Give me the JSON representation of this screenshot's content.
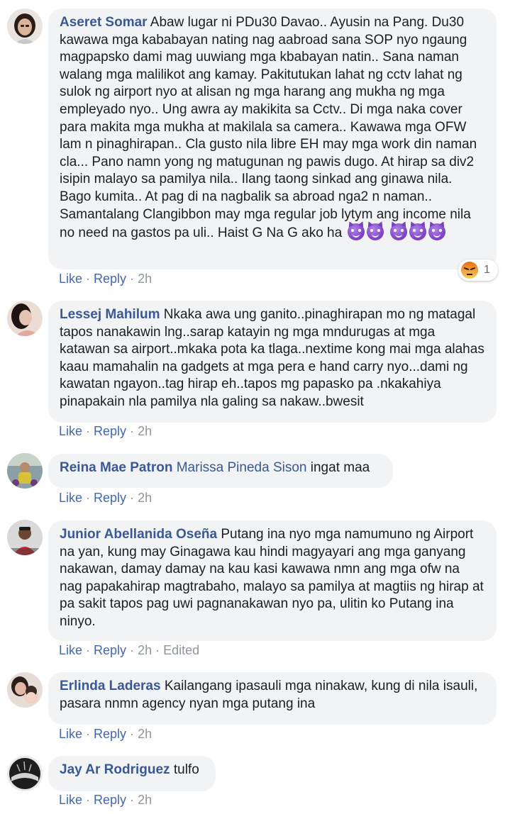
{
  "comments": [
    {
      "author": "Aseret Somar",
      "text": "Abaw lugar ni PDu30 Davao.. Ayusin na Pang. Du30 kawawa mga kababayan nating nag aabroad sana SOP nyo ngaung magpapsko dami mag uuwiang mga kbabayan natin.. Sana naman walang mga malilikot ang kamay. Pakitutukan lahat ng cctv lahat ng sulok ng airport nyo at alisan ng mga harang ang mukha ng mga empleyado nyo.. Ung awra ay makikita sa Cctv.. Di mga naka cover para makita mga mukha at makilala sa camera.. Kawawa mga OFW lam n pinaghirapan.. Cla gusto nila libre EH may mga work din naman cla... Pano namn yong ng matugunan ng pawis dugo. At hirap sa div2 isipin malayo sa pamilya nila.. Ilang taong sinkad ang ginawa nila. Bago kumita.. At pag di na nagbalik sa abroad nga2 n naman.. Samantalang Clangibbon may mga regular job lytym ang income nila no need na gastos pa uli.. Haist G Na G ako ha",
      "like": "Like",
      "reply": "Reply",
      "time": "2h",
      "reaction_count": "1",
      "emoji_icon": "smiling-devil-emoji-icon"
    },
    {
      "author": "Lessej Mahilum",
      "text": "Nkaka awa ung ganito..pinaghirapan mo ng matagal tapos nanakawin lng..sarap katayin ng mga mndurugas at mga katawan sa airport..mkaka pota ka tlaga..nextime kong mai mga alahas kaau mamahalin na gadgets at mga pera e hand carry nyo...dami ng kawatan ngayon..tag hirap eh..tapos mg papasko pa .nkakahiya pinapakain nla pamilya nla galing sa nakaw..bwesit",
      "like": "Like",
      "reply": "Reply",
      "time": "2h"
    },
    {
      "author": "Reina Mae Patron",
      "mention": "Marissa Pineda Sison",
      "text": "ingat maa",
      "like": "Like",
      "reply": "Reply",
      "time": "2h"
    },
    {
      "author": "Junior Abellanida Oseña",
      "text": "Putang ina nyo mga namumuno ng Airport na yan, kung may Ginagawa kau hindi magyayari ang mga ganyang nakawan, damay damay na kau kasi kawawa nmn ang mga ofw na nag papakahirap magtrabaho, malayo sa pamilya at magtiis ng hirap at pa sakit tapos pag uwi pagnanakawan nyo pa, ulitin ko Putang ina ninyo.",
      "like": "Like",
      "reply": "Reply",
      "time": "2h",
      "edited": "Edited"
    },
    {
      "author": "Erlinda Laderas",
      "text": "Kailangang ipasauli mga ninakaw, kung di nila isauli, pasara nnmn agency nyan mga putang ina",
      "like": "Like",
      "reply": "Reply",
      "time": "2h"
    },
    {
      "author": "Jay Ar Rodriguez",
      "text": "tulfo",
      "like": "Like",
      "reply": "Reply",
      "time": "2h"
    }
  ],
  "colors": {
    "author": "#385898",
    "link": "#4267b2",
    "muted": "#90949c",
    "bubble": "#f2f3f5"
  }
}
